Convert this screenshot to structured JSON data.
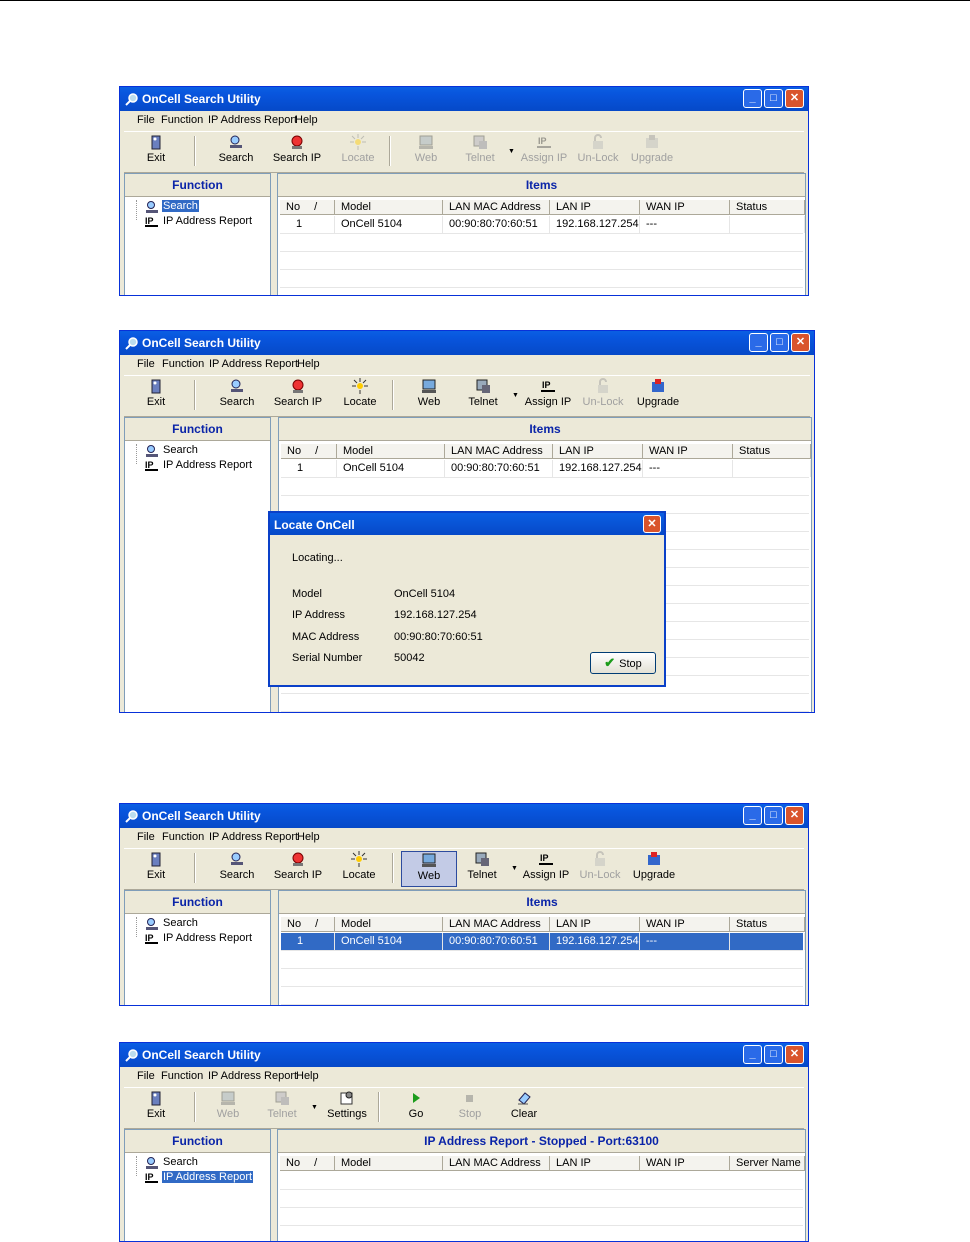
{
  "app": {
    "title": "OnCell Search Utility",
    "menu": [
      "File",
      "Function",
      "IP Address Report",
      "Help"
    ],
    "minimize": "_",
    "maximize": "□",
    "close": "✕",
    "function_header": "Function",
    "tree": [
      "Search",
      "IP Address Report"
    ]
  },
  "toolbar": {
    "exit": "Exit",
    "search": "Search",
    "search_ip": "Search IP",
    "locate": "Locate",
    "web": "Web",
    "telnet": "Telnet",
    "assign_ip": "Assign IP",
    "unlock": "Un-Lock",
    "upgrade": "Upgrade",
    "settings": "Settings",
    "go": "Go",
    "stop": "Stop",
    "clear": "Clear",
    "dropdown_arrow": "▼"
  },
  "items_header": "Items",
  "columns": [
    "No",
    "/",
    "Model",
    "LAN MAC Address",
    "LAN IP",
    "WAN IP",
    "Status"
  ],
  "device_row": {
    "no": "1",
    "model": "OnCell 5104",
    "mac": "00:90:80:70:60:51",
    "lan_ip": "192.168.127.254",
    "wan_ip": "---",
    "status": ""
  },
  "locate_dialog": {
    "title": "Locate OnCell",
    "status": "Locating...",
    "model_label": "Model",
    "model_value": "OnCell 5104",
    "ip_label": "IP Address",
    "ip_value": "192.168.127.254",
    "mac_label": "MAC Address",
    "mac_value": "00:90:80:70:60:51",
    "serial_label": "Serial Number",
    "serial_value": "50042",
    "stop_button": "Stop",
    "close": "✕"
  },
  "report": {
    "header": "IP Address Report - Stopped - Port:63100",
    "columns": [
      "No",
      "/",
      "Model",
      "LAN MAC Address",
      "LAN IP",
      "WAN IP",
      "Server Name"
    ]
  },
  "colors": {
    "title_blue": "#0649c8",
    "selection": "#316ac5",
    "panel_header_text": "#0a24a8",
    "window_bg": "#ece9d8"
  }
}
